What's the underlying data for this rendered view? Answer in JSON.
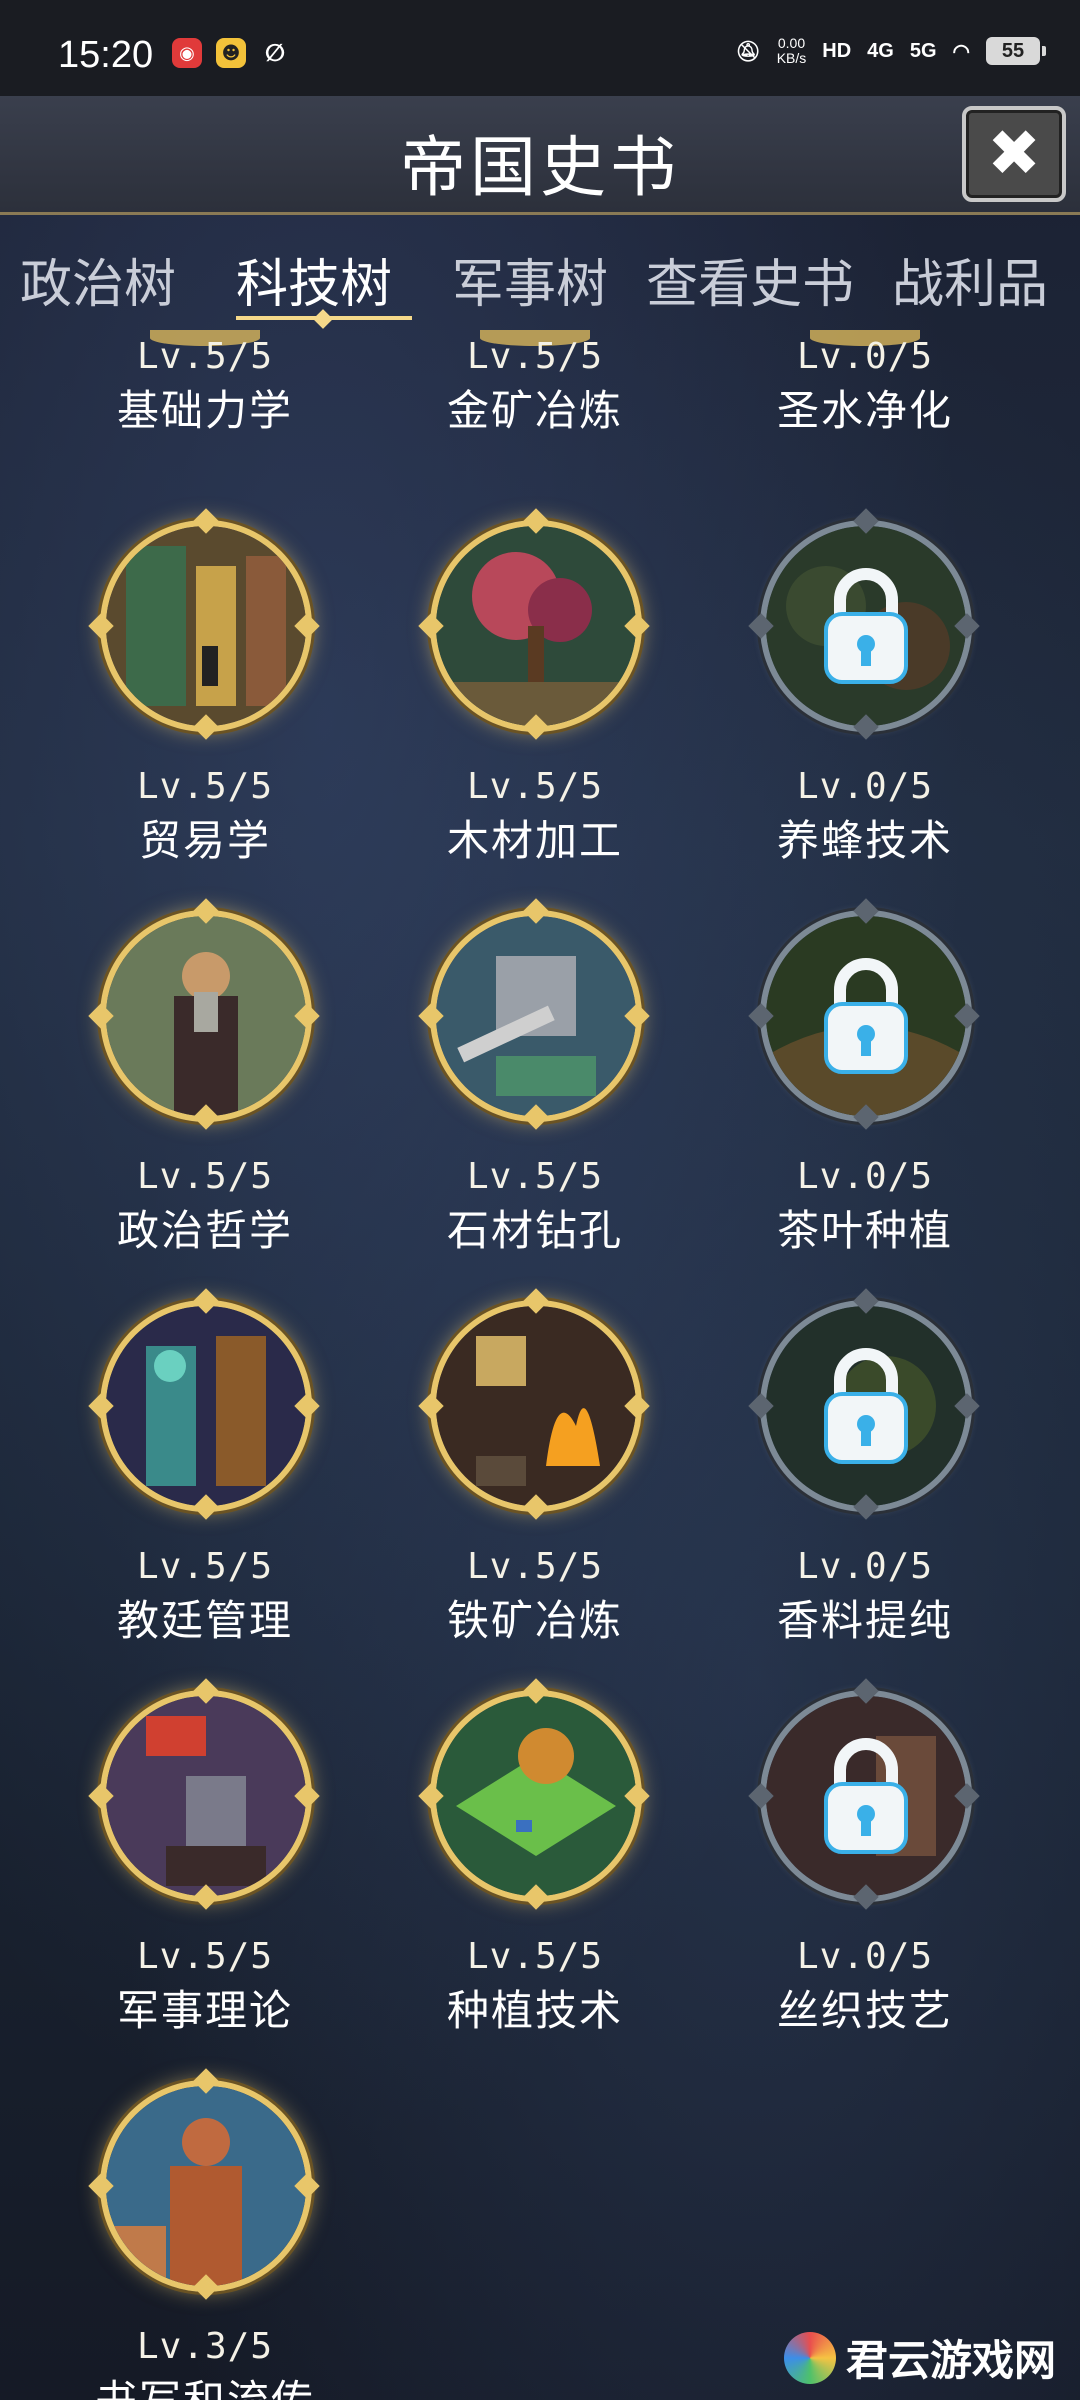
{
  "status_bar": {
    "time": "15:20",
    "net_speed_value": "0.00",
    "net_speed_unit": "KB/s",
    "hd": "HD",
    "sim1": "4G",
    "sim2": "5G",
    "battery": "55"
  },
  "header": {
    "title": "帝国史书",
    "close_icon": "close-icon"
  },
  "tabs": [
    {
      "label": "政治树",
      "active": false
    },
    {
      "label": "科技树",
      "active": true
    },
    {
      "label": "军事树",
      "active": false
    },
    {
      "label": "查看史书",
      "active": false
    },
    {
      "label": "战利品",
      "active": false
    }
  ],
  "techs": {
    "r0": [
      {
        "level": "Lv.5/5",
        "name": "基础力学",
        "locked": false
      },
      {
        "level": "Lv.5/5",
        "name": "金矿冶炼",
        "locked": false
      },
      {
        "level": "Lv.0/5",
        "name": "圣水净化",
        "locked": true
      }
    ],
    "r1": [
      {
        "level": "Lv.5/5",
        "name": "贸易学",
        "locked": false
      },
      {
        "level": "Lv.5/5",
        "name": "木材加工",
        "locked": false
      },
      {
        "level": "Lv.0/5",
        "name": "养蜂技术",
        "locked": true
      }
    ],
    "r2": [
      {
        "level": "Lv.5/5",
        "name": "政治哲学",
        "locked": false
      },
      {
        "level": "Lv.5/5",
        "name": "石材钻孔",
        "locked": false
      },
      {
        "level": "Lv.0/5",
        "name": "茶叶种植",
        "locked": true
      }
    ],
    "r3": [
      {
        "level": "Lv.5/5",
        "name": "教廷管理",
        "locked": false
      },
      {
        "level": "Lv.5/5",
        "name": "铁矿冶炼",
        "locked": false
      },
      {
        "level": "Lv.0/5",
        "name": "香料提纯",
        "locked": true
      }
    ],
    "r4": [
      {
        "level": "Lv.5/5",
        "name": "军事理论",
        "locked": false
      },
      {
        "level": "Lv.5/5",
        "name": "种植技术",
        "locked": false
      },
      {
        "level": "Lv.0/5",
        "name": "丝织技艺",
        "locked": true
      }
    ],
    "r5": [
      {
        "level": "Lv.3/5",
        "name": "书写和流传",
        "locked": false
      }
    ]
  },
  "watermark": {
    "text": "君云游戏网"
  }
}
